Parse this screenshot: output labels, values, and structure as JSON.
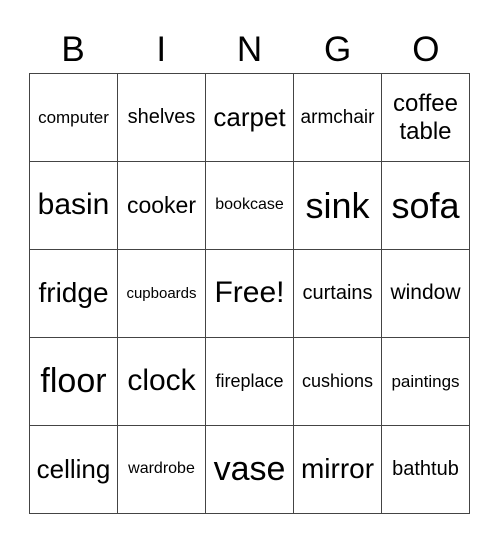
{
  "header": [
    "B",
    "I",
    "N",
    "G",
    "O"
  ],
  "cells": [
    "computer",
    "shelves",
    "carpet",
    "armchair",
    "coffee table",
    "basin",
    "cooker",
    "bookcase",
    "sink",
    "sofa",
    "fridge",
    "cupboards",
    "Free!",
    "curtains",
    "window",
    "floor",
    "clock",
    "fireplace",
    "cushions",
    "paintings",
    "celling",
    "wardrobe",
    "vase",
    "mirror",
    "bathtub"
  ]
}
